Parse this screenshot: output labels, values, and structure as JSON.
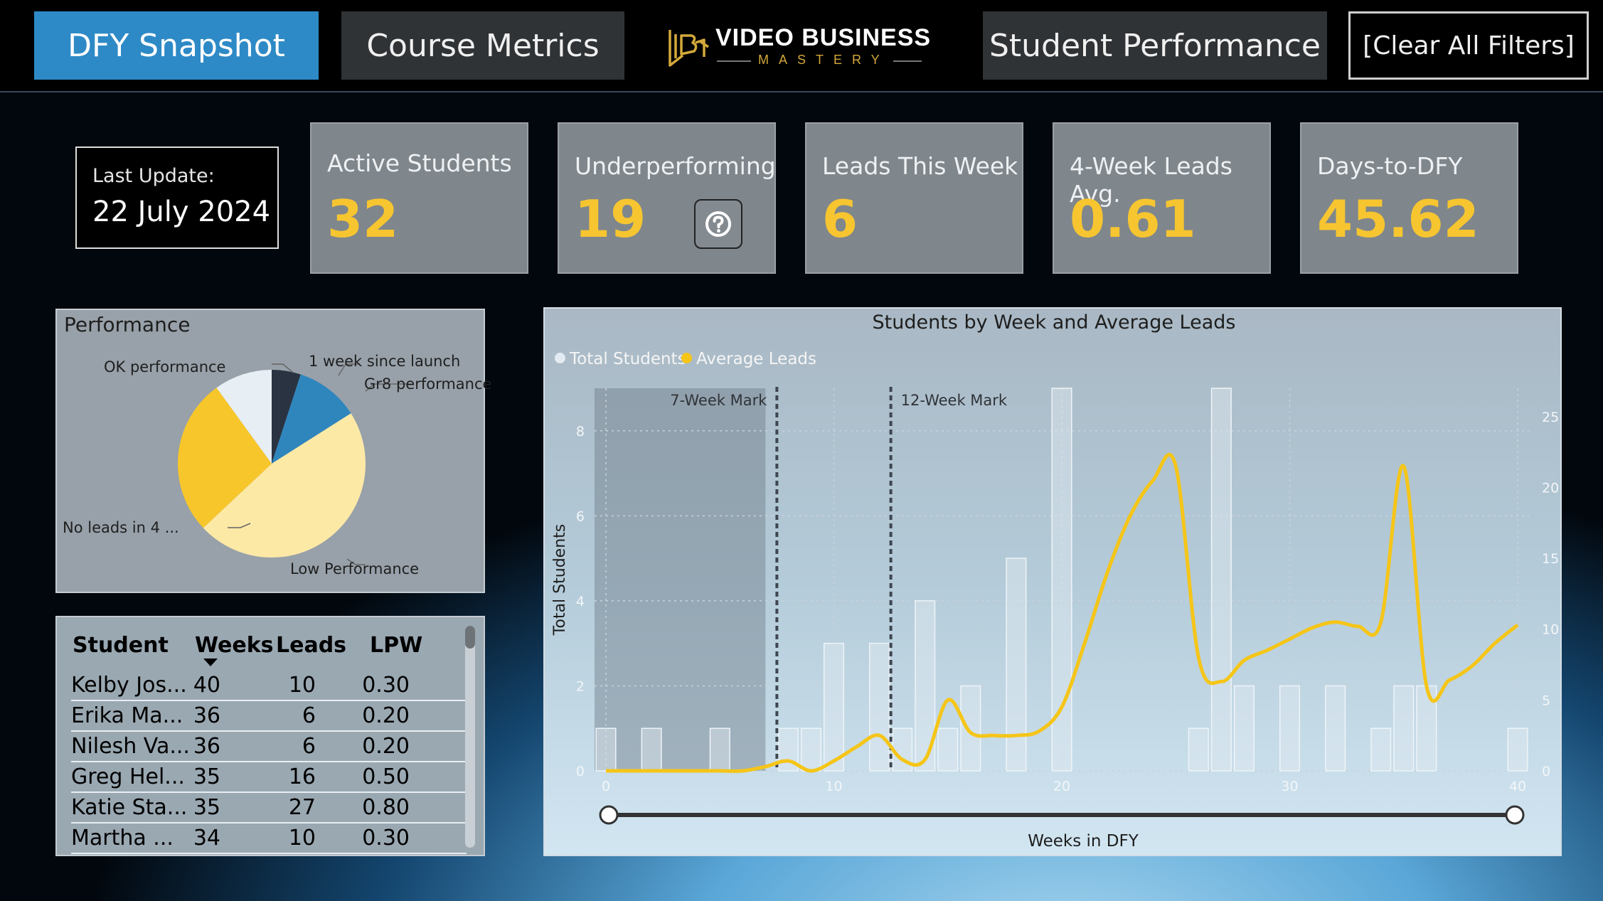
{
  "nav": {
    "snapshot": "DFY Snapshot",
    "course_metrics": "Course Metrics",
    "student_performance": "Student Performance",
    "clear_filters": "[Clear All Filters]"
  },
  "logo": {
    "line1": "VIDEO BUSINESS",
    "line2": "MASTERY"
  },
  "last_update": {
    "label": "Last Update:",
    "value": "22 July 2024"
  },
  "kpis": [
    {
      "label": "Active Students",
      "value": "32"
    },
    {
      "label": "Underperforming",
      "value": "19"
    },
    {
      "label": "Leads This Week",
      "value": "6"
    },
    {
      "label": "4-Week Leads Avg.",
      "value": "0.61"
    },
    {
      "label": "Days-to-DFY",
      "value": "45.62"
    }
  ],
  "performance": {
    "title": "Performance",
    "slices": [
      {
        "label": "1 week since launch",
        "value": 5,
        "color": "#2a3342"
      },
      {
        "label": "Gr8 performance",
        "value": 11,
        "color": "#2f86bd"
      },
      {
        "label": "Low Performance",
        "value": 47,
        "color": "#fde9a6"
      },
      {
        "label": "No leads in 4 ...",
        "value": 27,
        "color": "#f7c62b"
      },
      {
        "label": "OK performance",
        "value": 10,
        "color": "#e7eef4"
      }
    ]
  },
  "table": {
    "headers": {
      "student": "Student",
      "weeks": "Weeks",
      "leads": "Leads",
      "lpw": "LPW"
    },
    "rows": [
      {
        "student": "Kelby Jos...",
        "weeks": "40",
        "leads": "10",
        "lpw": "0.30"
      },
      {
        "student": "Erika Ma...",
        "weeks": "36",
        "leads": "6",
        "lpw": "0.20"
      },
      {
        "student": "Nilesh Va...",
        "weeks": "36",
        "leads": "6",
        "lpw": "0.20"
      },
      {
        "student": "Greg Hel...",
        "weeks": "35",
        "leads": "16",
        "lpw": "0.50"
      },
      {
        "student": "Katie Sta...",
        "weeks": "35",
        "leads": "27",
        "lpw": "0.80"
      },
      {
        "student": "Martha ...",
        "weeks": "34",
        "leads": "10",
        "lpw": "0.30"
      }
    ]
  },
  "chart_data": {
    "type": "bar",
    "title": "Students by Week and Average Leads",
    "xlabel": "Weeks in DFY",
    "ylabel": "Total Students",
    "xlim": [
      0,
      40
    ],
    "ylim": [
      0,
      9
    ],
    "y2lim": [
      0,
      27
    ],
    "x_ticks": [
      0,
      10,
      20,
      30,
      40
    ],
    "y_ticks": [
      0,
      2,
      4,
      6,
      8
    ],
    "y2_ticks": [
      0,
      5,
      10,
      15,
      20,
      25
    ],
    "annotations": [
      {
        "label": "7-Week Mark",
        "x": 7
      },
      {
        "label": "12-Week Mark",
        "x": 12
      }
    ],
    "series": [
      {
        "name": "Total Students",
        "color": "#e3ecf2",
        "points": [
          [
            0,
            1
          ],
          [
            2,
            1
          ],
          [
            5,
            1
          ],
          [
            8,
            1
          ],
          [
            9,
            1
          ],
          [
            10,
            3
          ],
          [
            12,
            3
          ],
          [
            13,
            1
          ],
          [
            14,
            4
          ],
          [
            15,
            1
          ],
          [
            16,
            2
          ],
          [
            18,
            5
          ],
          [
            20,
            9
          ],
          [
            26,
            1
          ],
          [
            27,
            9
          ],
          [
            28,
            2
          ],
          [
            30,
            2
          ],
          [
            32,
            2
          ],
          [
            34,
            1
          ],
          [
            35,
            2
          ],
          [
            36,
            2
          ],
          [
            40,
            1
          ]
        ]
      },
      {
        "name": "Average Leads",
        "color": "#f5c518",
        "axis": "right",
        "points": [
          [
            0,
            0
          ],
          [
            1,
            0
          ],
          [
            2,
            0
          ],
          [
            3,
            0
          ],
          [
            4,
            0
          ],
          [
            5,
            0
          ],
          [
            6,
            0
          ],
          [
            7,
            0.3
          ],
          [
            8,
            0.7
          ],
          [
            9,
            0
          ],
          [
            10,
            0.7
          ],
          [
            11,
            1.7
          ],
          [
            12,
            2.5
          ],
          [
            13,
            0.8
          ],
          [
            14,
            0.8
          ],
          [
            15,
            5
          ],
          [
            16,
            2.7
          ],
          [
            17,
            2.5
          ],
          [
            18,
            2.5
          ],
          [
            19,
            2.8
          ],
          [
            20,
            4.5
          ],
          [
            21,
            9
          ],
          [
            22,
            14
          ],
          [
            23,
            18
          ],
          [
            24,
            20.5
          ],
          [
            25,
            21.5
          ],
          [
            26,
            8
          ],
          [
            27,
            6.3
          ],
          [
            28,
            7.8
          ],
          [
            29,
            8.5
          ],
          [
            30,
            9.3
          ],
          [
            31,
            10.1
          ],
          [
            32,
            10.5
          ],
          [
            33,
            10.2
          ],
          [
            34,
            10.5
          ],
          [
            35,
            21.5
          ],
          [
            36,
            6
          ],
          [
            37,
            6.4
          ],
          [
            38,
            7.4
          ],
          [
            39,
            9
          ],
          [
            40,
            10.3
          ]
        ]
      }
    ]
  }
}
